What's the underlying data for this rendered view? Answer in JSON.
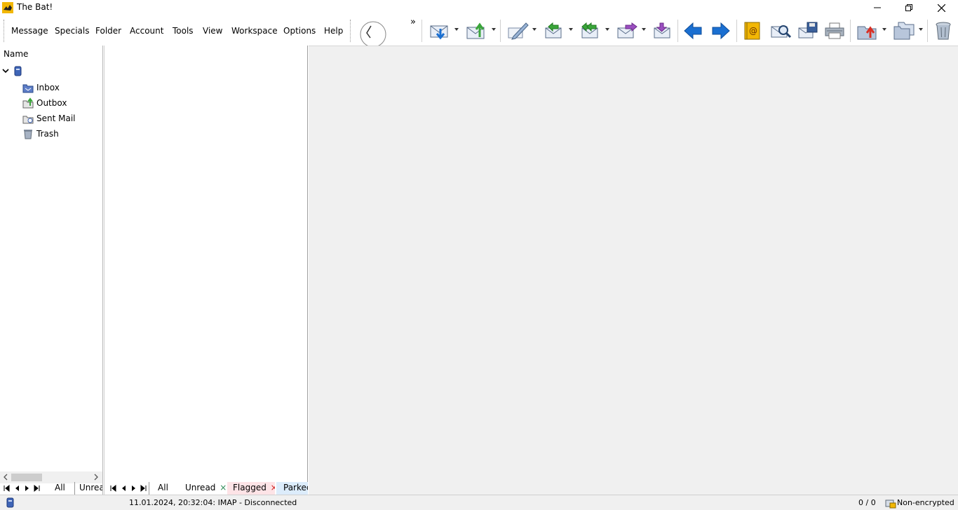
{
  "window": {
    "title": "The Bat!",
    "minimize_icon": "minimize-icon",
    "maximize_icon": "restore-icon",
    "close_icon": "close-icon"
  },
  "menu": {
    "items": [
      "Message",
      "Specials",
      "Folder",
      "Account",
      "Tools",
      "View",
      "Workspace",
      "Options",
      "Help"
    ],
    "overflow": "»"
  },
  "toolbar": {
    "icons": [
      "back-circle-icon",
      "get-mail-icon",
      "send-mail-icon",
      "new-message-icon",
      "reply-icon",
      "reply-all-icon",
      "forward-icon",
      "redirect-icon",
      "previous-icon",
      "next-icon",
      "address-book-icon",
      "find-icon",
      "save-message-icon",
      "print-icon",
      "move-to-folder-icon",
      "copy-to-folder-icon",
      "delete-icon"
    ]
  },
  "folders": {
    "header": "Name",
    "items": [
      {
        "label": "Inbox",
        "icon": "inbox-icon"
      },
      {
        "label": "Outbox",
        "icon": "outbox-icon"
      },
      {
        "label": "Sent Mail",
        "icon": "sent-mail-icon"
      },
      {
        "label": "Trash",
        "icon": "trash-icon"
      }
    ]
  },
  "folder_tabs": [
    "All",
    "Unrea"
  ],
  "list_tabs": [
    {
      "label": "All"
    },
    {
      "label": "Unread",
      "close": "×",
      "close_color": "#2e8b57"
    },
    {
      "label": "Flagged",
      "close": "×",
      "close_color": "#d02020"
    },
    {
      "label": "Parkec"
    }
  ],
  "status": {
    "log": "11.01.2024, 20:32:04: IMAP  - Disconnected",
    "counter": "0 / 0",
    "encryption": "Non-encrypted"
  },
  "colors": {
    "accent_blue": "#1a6fd1",
    "accent_green": "#3aa53a",
    "accent_purple": "#9b4fc0",
    "folder_blue": "#3f65b7"
  }
}
